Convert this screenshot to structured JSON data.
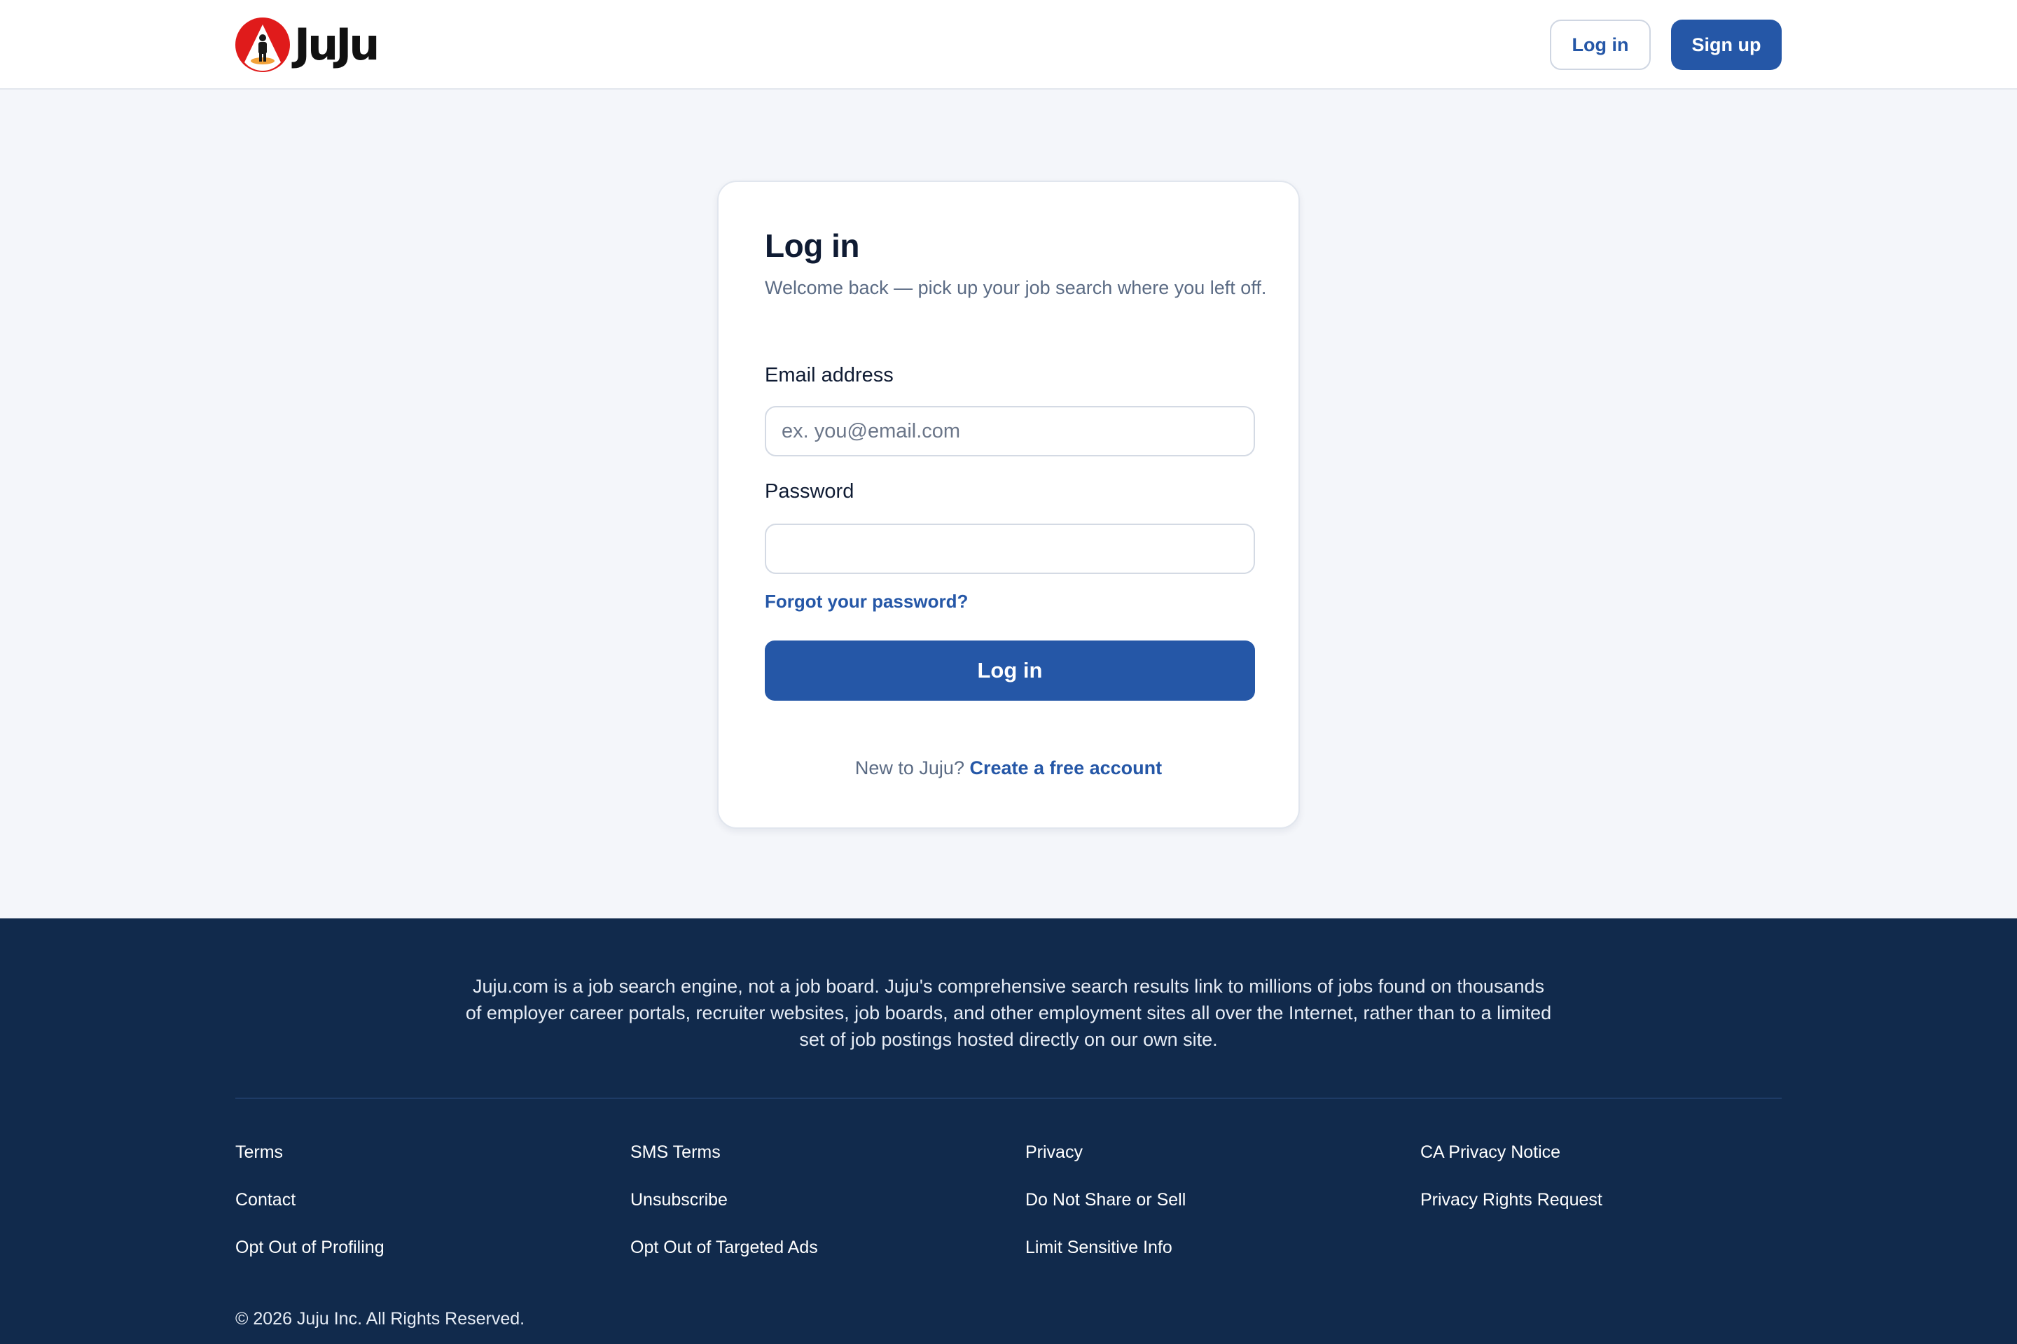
{
  "header": {
    "brand": "JuJu",
    "login_label": "Log in",
    "signup_label": "Sign up"
  },
  "login_card": {
    "title": "Log in",
    "subtitle": "Welcome back — pick up your job search where you left off.",
    "email_label": "Email address",
    "email_placeholder": "ex. you@email.com",
    "email_value": "",
    "password_label": "Password",
    "password_value": "",
    "forgot_label": "Forgot your password?",
    "submit_label": "Log in",
    "new_user_text": "New to Juju?",
    "create_account_label": "Create a free account"
  },
  "footer": {
    "about": "Juju.com is a job search engine, not a job board. Juju's comprehensive search results link to millions of jobs found on thousands of employer career portals, recruiter websites, job boards, and other employment sites all over the Internet, rather than to a limited set of job postings hosted directly on our own site.",
    "links": {
      "terms": "Terms",
      "sms_terms": "SMS Terms",
      "privacy": "Privacy",
      "ca_privacy": "CA Privacy Notice",
      "contact": "Contact",
      "unsubscribe": "Unsubscribe",
      "do_not_share": "Do Not Share or Sell",
      "privacy_rights": "Privacy Rights Request",
      "opt_out_profiling": "Opt Out of Profiling",
      "opt_out_ads": "Opt Out of Targeted Ads",
      "limit_sensitive": "Limit Sensitive Info"
    },
    "copyright": "© 2026 Juju Inc. All Rights Reserved."
  },
  "colors": {
    "primary": "#2557a7",
    "footer_bg": "#112a4c",
    "page_bg": "#f4f6fa",
    "logo_red": "#e01b1b"
  },
  "icons": {
    "logo": "juju-logo-icon"
  }
}
